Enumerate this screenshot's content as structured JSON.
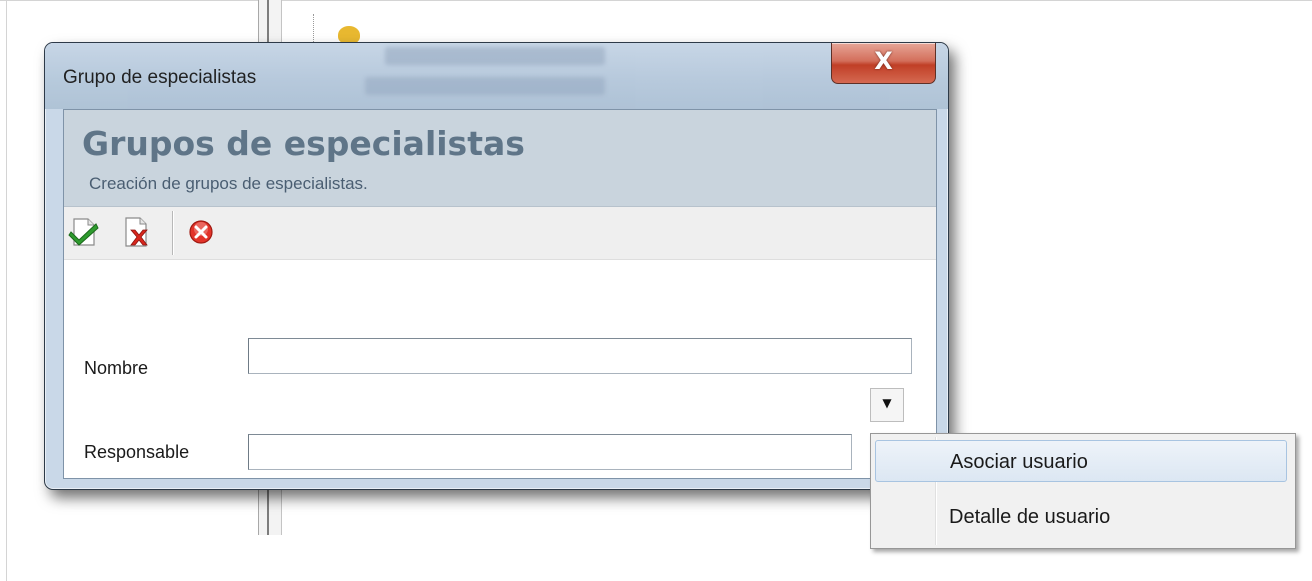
{
  "dialog": {
    "title": "Grupo de especialistas",
    "close_glyph": "X"
  },
  "header": {
    "heading": "Grupos de especialistas",
    "subtitle": "Creación de grupos de especialistas."
  },
  "toolbar": {
    "buttons": [
      {
        "icon": "check-document-icon"
      },
      {
        "icon": "delete-document-icon"
      },
      {
        "icon": "cancel-icon"
      }
    ]
  },
  "form": {
    "nombre_label": "Nombre",
    "nombre_value": "",
    "responsable_label": "Responsable",
    "responsable_value": "",
    "dropdown_glyph": "▼"
  },
  "context_menu": {
    "items": [
      {
        "label": "Asociar usuario",
        "highlighted": true
      },
      {
        "label": "Detalle de usuario",
        "highlighted": false
      }
    ]
  },
  "colors": {
    "header_title": "#5f7588",
    "close_button": "#c0391f",
    "menu_highlight": "#dce7f3"
  }
}
